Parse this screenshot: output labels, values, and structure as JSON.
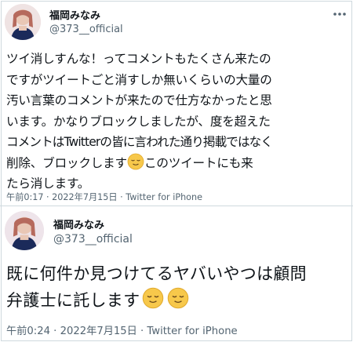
{
  "tweets": [
    {
      "author_name": "福岡みなみ",
      "author_handle": "@373__official",
      "text_lines": [
        "ツイ消しすんな！ってコメントもたくさん来たの",
        "ですがツイートごと消すしか無いくらいの大量の",
        "汚い言葉のコメントが来たので仕方なかったと思",
        "います。かなりブロックしましたが、度を超えた",
        "コメントはTwitterの皆に言われた通り掲載ではなく",
        "削除、ブロックします",
        "このツイートにも来",
        "たら消します。"
      ],
      "emoji": "relieved-face",
      "timestamp": "午前0:17 · 2022年7月15日 · Twitter for iPhone"
    },
    {
      "author_name": "福岡みなみ",
      "author_handle": "@373__official",
      "text_lines": [
        "既に何件か見つけてるヤバいやつは顧問",
        "弁護士に託します"
      ],
      "emoji": "relieved-face",
      "timestamp": "午前0:24 · 2022年7月15日 · Twitter for iPhone"
    }
  ],
  "colors": {
    "text": "#0f1419",
    "secondary": "#536471",
    "border": "#cfd9de",
    "emoji_face": "#f7c84b"
  },
  "icons": {
    "more": "more-options-icon",
    "emoji": "relieved-face-emoji"
  }
}
